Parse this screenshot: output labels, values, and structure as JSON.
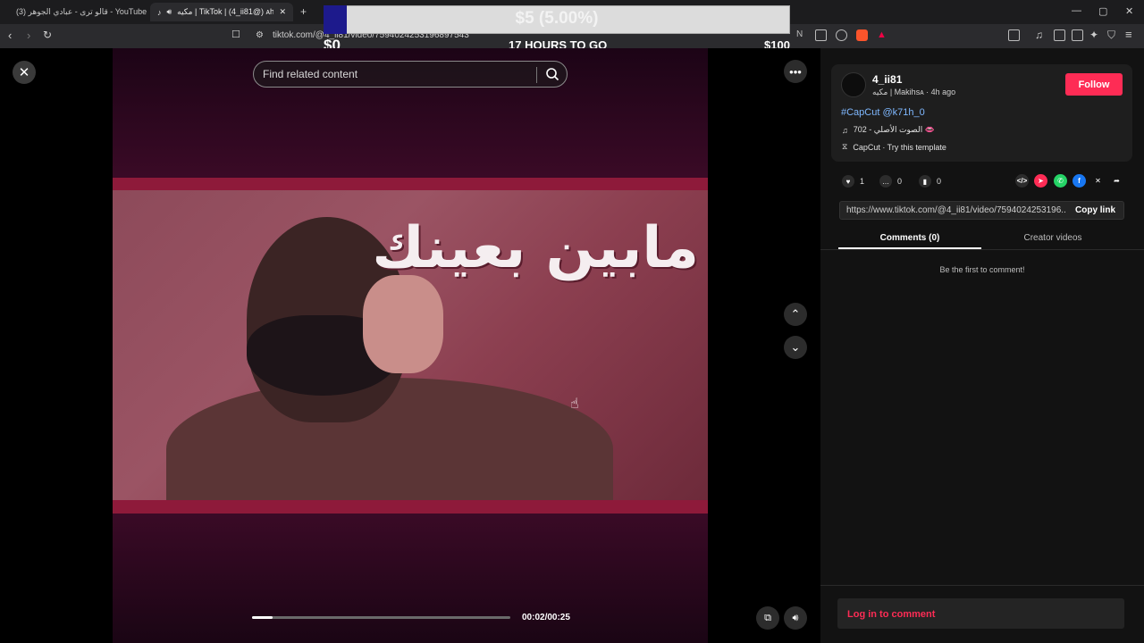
{
  "browser": {
    "tabs": [
      {
        "label": "(3) قالو ترى - عبادي الجوهر - YouTube",
        "icon": "youtube-icon"
      },
      {
        "label": "مكيه | TikTok | (4_ii81@) ᴀhsa",
        "icon": "tiktok-icon"
      }
    ],
    "new_tab": "+",
    "url": "tiktok.com/@4_ii81/video/7594024253196897543",
    "window_controls": [
      "—",
      "▢",
      "✕"
    ]
  },
  "donation": {
    "amount": "$5 (5.00%)",
    "min": "$0",
    "max": "$100",
    "countdown": "17 HOURS TO GO",
    "fraction": 0.05
  },
  "video": {
    "search_placeholder": "Find related content",
    "caption": "مابين بعينك",
    "current_time": "00:02",
    "duration": "00:25",
    "time_label": "00:02/00:25",
    "progress": 0.08
  },
  "post": {
    "username": "4_ii81",
    "display_line": "مكيه | Makihsᴀ · 4h ago",
    "follow_label": "Follow",
    "hashtags": "#CapCut @k71h_0",
    "sound": "702 - الصوت الأصلي 👄",
    "template": "CapCut · Try this template",
    "likes": "1",
    "comments": "0",
    "saves": "0",
    "link": "https://www.tiktok.com/@4_ii81/video/7594024253196...",
    "copy_label": "Copy link",
    "tabs": [
      "Comments (0)",
      "Creator videos"
    ],
    "empty_message": "Be the first to comment!",
    "login_prompt": "Log in to comment"
  },
  "colors": {
    "accent": "#fe2c55",
    "donation_fill": "#1d1a8c"
  }
}
